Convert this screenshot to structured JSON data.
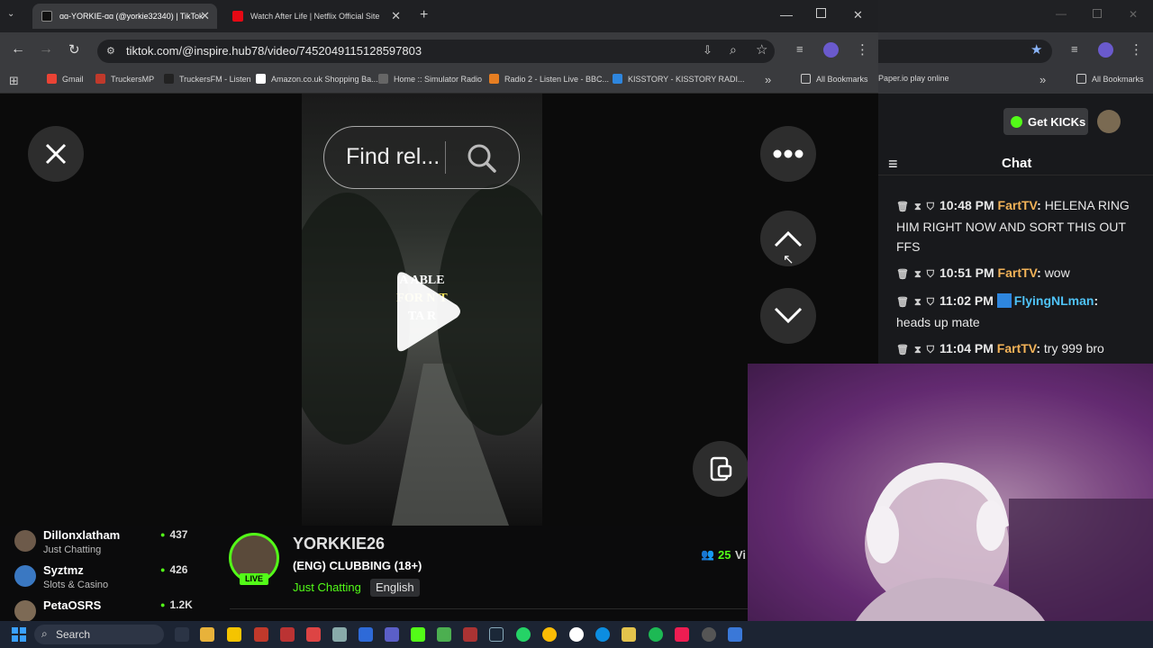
{
  "browser": {
    "tabs": [
      {
        "label": "ɑɑ-YORKIE-ɑɑ (@yorkie32340) | TikTok",
        "active": true
      },
      {
        "label": "Watch After Life | Netflix Official Site",
        "active": false
      }
    ],
    "url": "tiktok.com/@inspire.hub78/video/7452049115128597803",
    "bookmarks": [
      {
        "label": "Gmail"
      },
      {
        "label": "TruckersMP"
      },
      {
        "label": "TruckersFM - Listen"
      },
      {
        "label": "Amazon.co.uk Shopping Ba..."
      },
      {
        "label": "Home :: Simulator Radio"
      },
      {
        "label": "Radio 2 - Listen Live - BBC..."
      },
      {
        "label": "KISSTORY - KISSTORY RADI..."
      },
      {
        "label": "All Bookmarks"
      }
    ],
    "right_bookmarks": [
      {
        "label": "Paper.io play online"
      },
      {
        "label": "All Bookmarks"
      }
    ]
  },
  "tiktok": {
    "search_placeholder": "Find rel...",
    "video_text": [
      "A      ABLE",
      "FOR     N'T",
      "TA         R"
    ]
  },
  "kick_chat": {
    "get_kicks_label": "Get KICKs",
    "title": "Chat",
    "messages": [
      {
        "time": "10:48 PM",
        "user": "FartTV",
        "text": "HELENA RING HIM RIGHT NOW AND SORT THIS OUT FFS"
      },
      {
        "time": "10:51 PM",
        "user": "FartTV",
        "text": "wow"
      },
      {
        "time": "11:02 PM",
        "user": "FlyingNLman",
        "text": "heads up mate"
      },
      {
        "time": "11:04 PM",
        "user": "FartTV",
        "text": "try 999 bro"
      }
    ]
  },
  "kick_sidebar": {
    "channels": [
      {
        "name": "Dillonxlatham",
        "category": "Just Chatting",
        "viewers": "437"
      },
      {
        "name": "Syztmz",
        "category": "Slots & Casino",
        "viewers": "426"
      },
      {
        "name": "PetaOSRS",
        "category": "",
        "viewers": "1.2K"
      }
    ]
  },
  "stream": {
    "streamer": "YORKKIE26",
    "title": "(ENG) CLUBBING (18+)",
    "category": "Just Chatting",
    "language": "English",
    "live_badge": "LIVE",
    "viewer_count": "25",
    "viewer_suffix": "Vi"
  },
  "taskbar": {
    "search_label": "Search"
  },
  "colors": {
    "kick_green": "#53fc18",
    "chat_orange": "#f3b358",
    "chat_blue": "#4fc3f7",
    "webcam_purple": "#8e5a92"
  }
}
